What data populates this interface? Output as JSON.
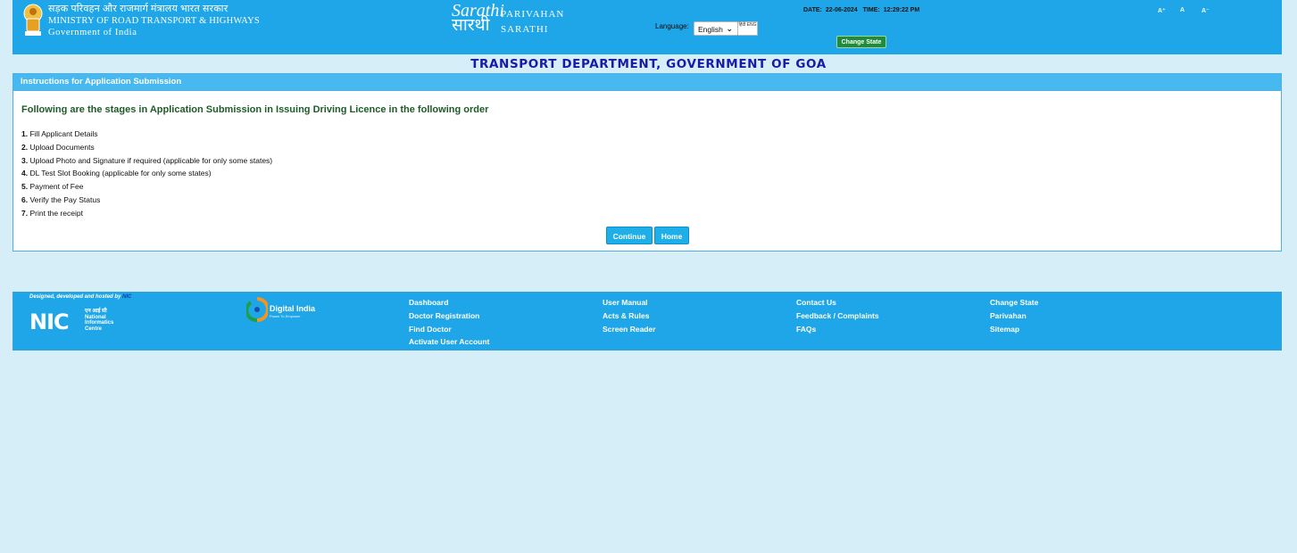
{
  "header": {
    "ministry_hindi": "सड़क परिवहन और राजमार्ग मंत्रालय भारत सरकार",
    "ministry_english": "MINISTRY OF ROAD TRANSPORT & HIGHWAYS",
    "government": "Government of India",
    "logo_line1": "Sarathi",
    "logo_line2": "सारथी",
    "brand_line1": "PARIVAHAN",
    "brand_line2": "SARATHI",
    "language_label": "Language:",
    "language_value": "English",
    "language_badge": "हिंदी ENG",
    "date_label": "DATE:",
    "date_value": "22-06-2024",
    "time_label": "TIME:",
    "time_value": "12:29:22 PM",
    "change_state": "Change State",
    "font_controls": [
      "A⁺",
      "A",
      "A⁻"
    ]
  },
  "page_title": "TRANSPORT DEPARTMENT, GOVERNMENT OF GOA",
  "panel": {
    "heading": "Instructions for Application Submission",
    "stages_heading": "Following are the stages in Application Submission in Issuing Driving Licence in the following order",
    "steps": [
      {
        "num": "1.",
        "text": " Fill Applicant Details"
      },
      {
        "num": "2.",
        "text": " Upload Documents"
      },
      {
        "num": "3.",
        "text": " Upload Photo and Signature if required (applicable for only some states)"
      },
      {
        "num": "4.",
        "text": " DL Test Slot Booking (applicable for only some states)"
      },
      {
        "num": "5.",
        "text": " Payment of Fee"
      },
      {
        "num": "6.",
        "text": " Verify the Pay Status"
      },
      {
        "num": "7.",
        "text": " Print the receipt"
      }
    ],
    "continue_label": "Continue",
    "home_label": "Home"
  },
  "footer": {
    "designed_text": "Designed, developed and hosted by",
    "designed_link": "NIC",
    "nic_logo_big": "NIC",
    "nic_hindi": "एन आई सी",
    "nic_line1": "National",
    "nic_line2": "Informatics",
    "nic_line3": "Centre",
    "digital_india": "Digital India",
    "digital_india_sub": "Power To Empower",
    "col1": [
      "Dashboard",
      "Doctor Registration",
      "Find Doctor",
      "Activate User Account"
    ],
    "col2": [
      "User Manual",
      "Acts & Rules",
      "Screen Reader"
    ],
    "col3": [
      "Contact Us",
      "Feedback / Complaints",
      "FAQs"
    ],
    "col4": [
      "Change State",
      "Parivahan",
      "Sitemap"
    ]
  },
  "colors": {
    "header_bg": "#1fa6e8",
    "page_bg": "#d6eef8",
    "title_color": "#1a1aa8",
    "stages_heading_color": "#1f5a2a",
    "change_state_bg": "#1e8c3a"
  }
}
